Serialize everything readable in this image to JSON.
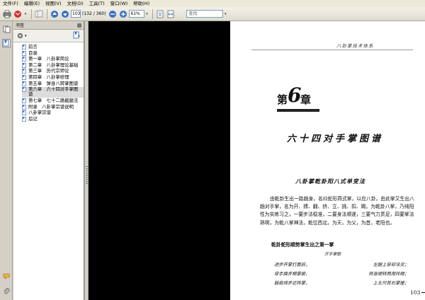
{
  "menu": [
    "文件(F)",
    "编辑(E)",
    "视图(V)",
    "文档(D)",
    "工具(T)",
    "窗口(W)",
    "帮助(H)"
  ],
  "toolbar": {
    "current_page": "103",
    "page_total": "(132 / 360)",
    "zoom": "61%",
    "search_placeholder": "查找"
  },
  "panel": {
    "title": "书签",
    "bookmarks": [
      {
        "label": "前言"
      },
      {
        "label": "目录"
      },
      {
        "label": "第一章　八卦掌简论"
      },
      {
        "label": "第二章　八卦掌理论基础"
      },
      {
        "label": "第三章　历代宗师论"
      },
      {
        "label": "第四章　八卦掌修理"
      },
      {
        "label": "第五章　弹身八转掌图谱"
      },
      {
        "label": "第六章　六十四对手掌图谱",
        "selected": true
      },
      {
        "label": "第七章　七十二路截腿法"
      },
      {
        "label": "附录　八卦掌宗谱说明"
      },
      {
        "label": "八卦掌宗谱"
      },
      {
        "label": "后记"
      }
    ]
  },
  "document": {
    "running_header": "八卦掌技术体系",
    "chapter_prefix": "第",
    "chapter_number": "6",
    "chapter_suffix": "章",
    "chapter_title": "六十四对手掌图谱",
    "section_title": "八卦掌乾卦阳八式单变法",
    "paragraph": "由乾卦生出一路趟身，名曰蛇形燕式掌，以应八卦。由此掌又生出八趟对手掌，名为开、搏、翻、挤、立、挑、扣、踢。为乾卦八掌，乃纯阳性为实练习之，一要步法稳准，二要身法顺遂，三要气力贯足，四要掌法熟明，为乾八掌神法，乾位西北，为天，为父，为首，老阳也。",
    "subheading": "乾卦蛇形顺势掌生出之第一掌",
    "small_caption": "开字掌歌",
    "verses": [
      [
        "进步开掌打面前，",
        "左腿上穿却法灵；"
      ],
      [
        "穿手换步横掌披，",
        "转身顺转两用伴顺；"
      ],
      [
        "鼓肩持步近阵掌，",
        "上五尺首右掌撞；"
      ]
    ],
    "page_number": "103"
  },
  "colors": {
    "dark_background": "#000000",
    "chrome": "#d4d0c8",
    "page": "#ffffff"
  }
}
